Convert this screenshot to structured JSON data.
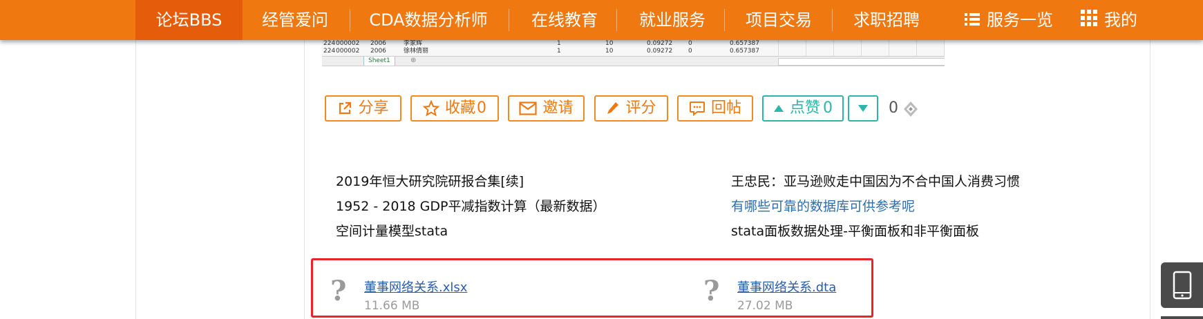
{
  "nav": {
    "items": [
      {
        "label": "论坛BBS",
        "active": true
      },
      {
        "label": "经管爱问"
      },
      {
        "label": "CDA数据分析师"
      },
      {
        "label": "在线教育"
      },
      {
        "label": "就业服务"
      },
      {
        "label": "项目交易"
      },
      {
        "label": "求职招聘"
      }
    ],
    "services_label": "服务一览",
    "mine_label": "我的",
    "colors": {
      "bar": "#f07810",
      "active": "#e55d0b"
    }
  },
  "sheet": {
    "rows": [
      [
        "224",
        "000002",
        "2006",
        "李家辉",
        "1",
        "10",
        "0.09272",
        "0",
        "0.657387"
      ],
      [
        "224",
        "000002",
        "2006",
        "徐林倩丽",
        "1",
        "10",
        "0.09272",
        "0",
        "0.657387"
      ]
    ],
    "tab_label": "Sheet1",
    "add_symbol": "⊕"
  },
  "actions": {
    "share_label": "分享",
    "favorite_label": "收藏",
    "favorite_count": "0",
    "invite_label": "邀请",
    "rate_label": "评分",
    "reply_label": "回帖",
    "like_label": "点赞",
    "like_count": "0",
    "coin_count": "0",
    "colors": {
      "orange": "#f08a1c",
      "teal": "#2cb5a8"
    }
  },
  "related": {
    "left": [
      {
        "title": "2019年恒大研究院研报合集[续]"
      },
      {
        "title": "1952 - 2018 GDP平减指数计算（最新数据）"
      },
      {
        "title": "空间计量模型stata"
      }
    ],
    "right": [
      {
        "title": "王忠民：亚马逊败走中国因为不合中国人消费习惯"
      },
      {
        "title": "有哪些可靠的数据库可供参考呢"
      },
      {
        "title": "stata面板数据处理-平衡面板和非平衡面板"
      }
    ]
  },
  "attachments": [
    {
      "icon": "?",
      "name": "董事网络关系.xlsx",
      "size": "11.66 MB"
    },
    {
      "icon": "?",
      "name": "董事网络关系.dta",
      "size": "27.02 MB"
    }
  ],
  "highlight_color": "#e8232a"
}
